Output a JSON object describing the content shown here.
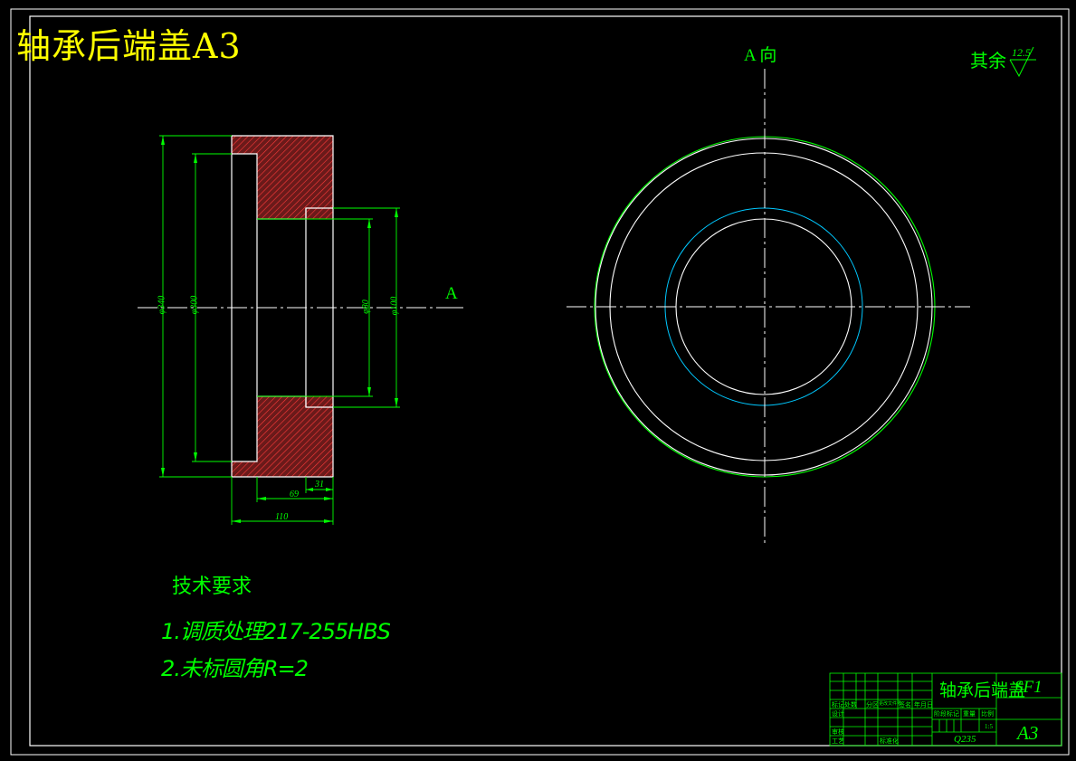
{
  "title": "轴承后端盖A3",
  "view_label": "A 向",
  "section_label": "A",
  "roughness": {
    "prefix": "其余",
    "value": "12.5"
  },
  "dimensions": {
    "d_outer": "φ340",
    "d_recess": "φ300",
    "d_bore": "φ80",
    "d_hub": "φ100",
    "w_hub": "31",
    "w_step": "69",
    "w_total": "110"
  },
  "tech_requirements": {
    "heading": "技术要求",
    "items": [
      "1.调质处理217-255HBS",
      "2.未标圆角R=2"
    ]
  },
  "title_block": {
    "part_name": "轴承后端盖",
    "drawing_code": "SF1",
    "sheet_format": "A3",
    "material": "Q235",
    "scale": "1:5",
    "header_cells": [
      "标记",
      "处数",
      "分区",
      "更改文件号",
      "签名",
      "年月日"
    ],
    "side_cells": [
      "设计",
      "审核",
      "工艺"
    ],
    "standard_cell": "标准化",
    "stage_cells": [
      "阶段标记",
      "重量",
      "比例"
    ]
  },
  "colors": {
    "background": "#000000",
    "frame": "#ffffff",
    "dimension": "#00ff00",
    "title": "#ffff00",
    "hatch_fill": "#7a1f1f",
    "hatch_line": "#ff3030",
    "inner_circle": "#00c8ff",
    "centerline": "#ffffff"
  }
}
